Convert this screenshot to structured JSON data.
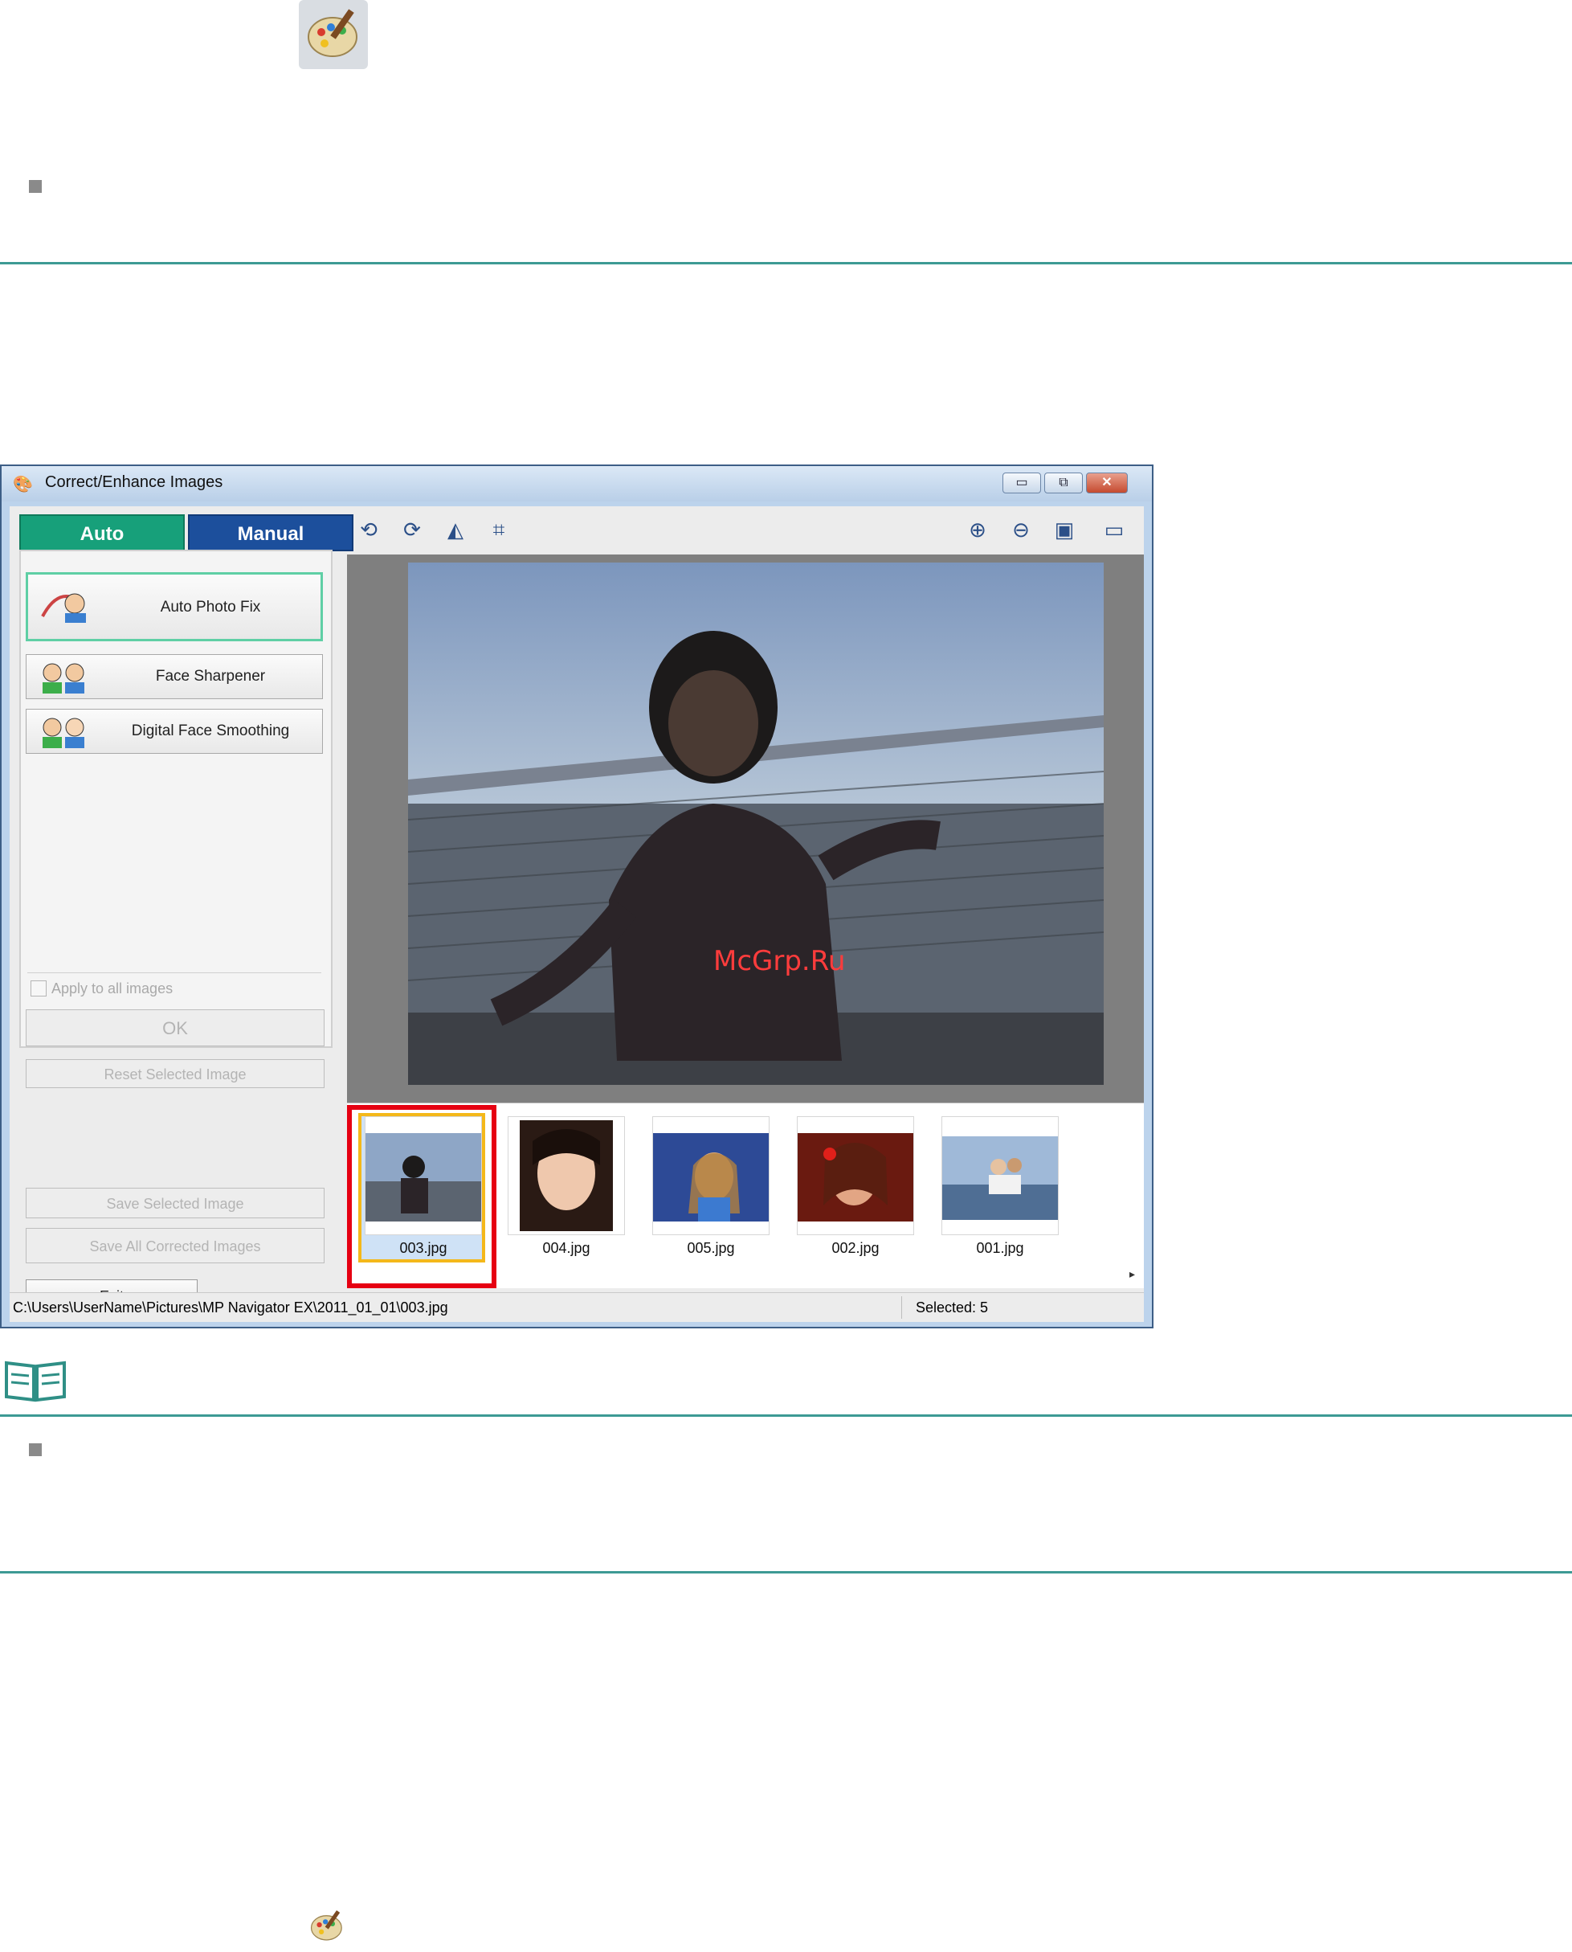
{
  "window": {
    "title": "Correct/Enhance Images",
    "buttons": {
      "minimize": "▭",
      "maximize": "⧉",
      "close": "✕"
    }
  },
  "tabs": {
    "auto": "Auto",
    "manual": "Manual"
  },
  "auto_panel": {
    "buttons": [
      {
        "label": "Auto Photo Fix"
      },
      {
        "label": "Face Sharpener"
      },
      {
        "label": "Digital Face Smoothing"
      }
    ],
    "apply_all_label": "Apply to all images",
    "ok_label": "OK",
    "reset_label": "Reset Selected Image"
  },
  "save": {
    "save_selected_label": "Save Selected Image",
    "save_all_label": "Save All Corrected Images"
  },
  "exit_label": "Exit",
  "thumbnails": [
    {
      "name": "003.jpg",
      "selected": true
    },
    {
      "name": "004.jpg"
    },
    {
      "name": "005.jpg"
    },
    {
      "name": "002.jpg"
    },
    {
      "name": "001.jpg"
    }
  ],
  "status": {
    "path": "C:\\Users\\UserName\\Pictures\\MP Navigator EX\\2011_01_01\\003.jpg",
    "selected": "Selected: 5"
  },
  "watermark": "McGrp.Ru",
  "colors": {
    "rule": "#3d9a94",
    "highlight": "#e60012",
    "auto_tab": "#17a07a",
    "manual_tab": "#1c4f9c"
  }
}
